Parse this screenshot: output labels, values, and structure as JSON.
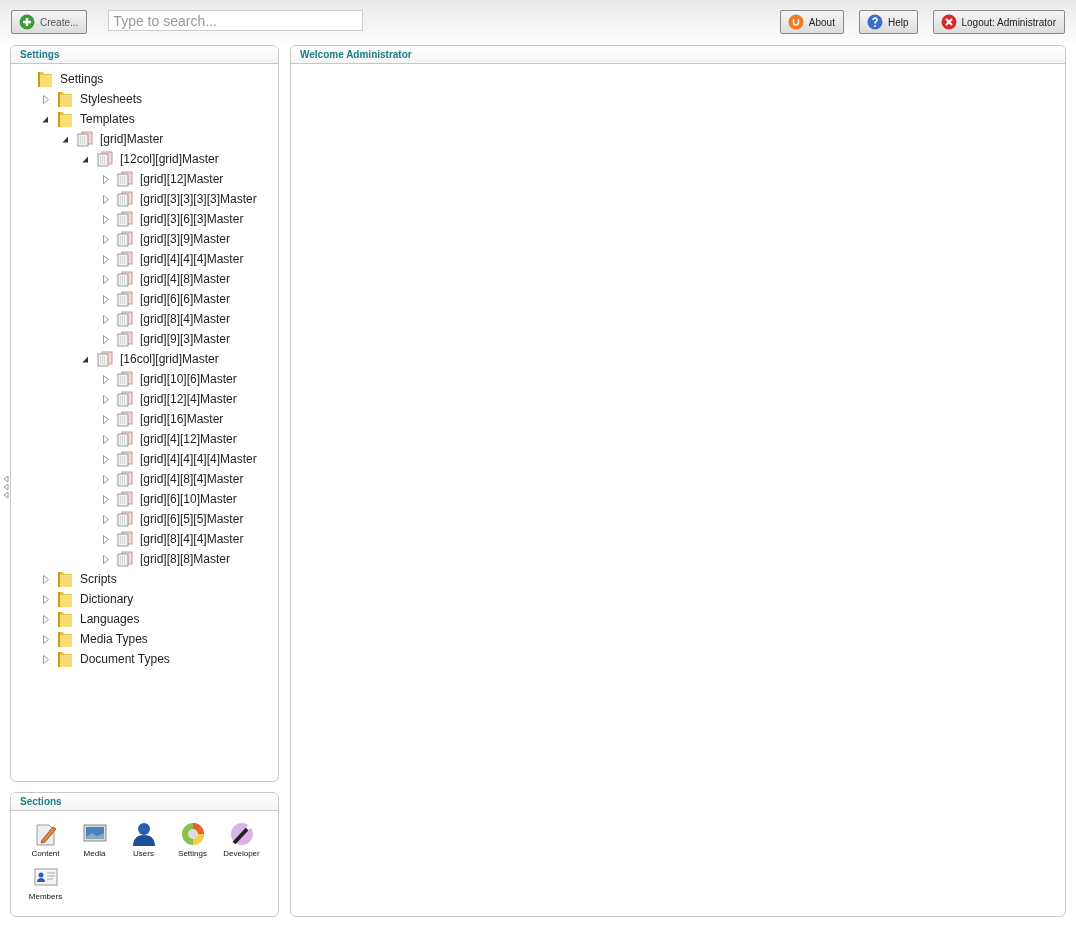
{
  "toolbar": {
    "create_button": "Create...",
    "search": {
      "placeholder": "Type to search..."
    },
    "buttons": [
      {
        "kind": "about",
        "label": "About"
      },
      {
        "kind": "help",
        "label": "Help"
      },
      {
        "kind": "logout",
        "label": "Logout: Administrator"
      }
    ]
  },
  "tree_panel": {
    "title": "Settings",
    "tree": [
      {
        "label": "Settings",
        "kind": "folder",
        "children": [
          {
            "label": "Stylesheets",
            "kind": "folder",
            "expanded": false
          },
          {
            "label": "Templates",
            "kind": "folder",
            "expanded": true,
            "children": [
              {
                "label": "[grid]Master",
                "kind": "template",
                "expanded": true,
                "children": [
                  {
                    "label": "[12col][grid]Master",
                    "kind": "template",
                    "expanded": true,
                    "children": [
                      {
                        "label": "[grid][12]Master",
                        "kind": "template",
                        "expanded": false
                      },
                      {
                        "label": "[grid][3][3][3][3]Master",
                        "kind": "template",
                        "expanded": false
                      },
                      {
                        "label": "[grid][3][6][3]Master",
                        "kind": "template",
                        "expanded": false
                      },
                      {
                        "label": "[grid][3][9]Master",
                        "kind": "template",
                        "expanded": false
                      },
                      {
                        "label": "[grid][4][4][4]Master",
                        "kind": "template",
                        "expanded": false
                      },
                      {
                        "label": "[grid][4][8]Master",
                        "kind": "template",
                        "expanded": false
                      },
                      {
                        "label": "[grid][6][6]Master",
                        "kind": "template",
                        "expanded": false
                      },
                      {
                        "label": "[grid][8][4]Master",
                        "kind": "template",
                        "expanded": false
                      },
                      {
                        "label": "[grid][9][3]Master",
                        "kind": "template",
                        "expanded": false
                      }
                    ]
                  },
                  {
                    "label": "[16col][grid]Master",
                    "kind": "template",
                    "expanded": true,
                    "children": [
                      {
                        "label": "[grid][10][6]Master",
                        "kind": "template",
                        "expanded": false
                      },
                      {
                        "label": "[grid][12][4]Master",
                        "kind": "template",
                        "expanded": false
                      },
                      {
                        "label": "[grid][16]Master",
                        "kind": "template",
                        "expanded": false
                      },
                      {
                        "label": "[grid][4][12]Master",
                        "kind": "template",
                        "expanded": false
                      },
                      {
                        "label": "[grid][4][4][4][4]Master",
                        "kind": "template",
                        "expanded": false
                      },
                      {
                        "label": "[grid][4][8][4]Master",
                        "kind": "template",
                        "expanded": false
                      },
                      {
                        "label": "[grid][6][10]Master",
                        "kind": "template",
                        "expanded": false
                      },
                      {
                        "label": "[grid][6][5][5]Master",
                        "kind": "template",
                        "expanded": false
                      },
                      {
                        "label": "[grid][8][4][4]Master",
                        "kind": "template",
                        "expanded": false
                      },
                      {
                        "label": "[grid][8][8]Master",
                        "kind": "template",
                        "expanded": false
                      }
                    ]
                  }
                ]
              }
            ]
          },
          {
            "label": "Scripts",
            "kind": "folder",
            "expanded": false
          },
          {
            "label": "Dictionary",
            "kind": "folder",
            "expanded": false
          },
          {
            "label": "Languages",
            "kind": "folder",
            "expanded": false
          },
          {
            "label": "Media Types",
            "kind": "folder",
            "expanded": false
          },
          {
            "label": "Document Types",
            "kind": "folder",
            "expanded": false
          }
        ]
      }
    ]
  },
  "sections_panel": {
    "title": "Sections",
    "sections": [
      {
        "kind": "content",
        "label": "Content"
      },
      {
        "kind": "media",
        "label": "Media"
      },
      {
        "kind": "users",
        "label": "Users"
      },
      {
        "kind": "settings",
        "label": "Settings"
      },
      {
        "kind": "developer",
        "label": "Developer"
      },
      {
        "kind": "members",
        "label": "Members"
      }
    ]
  },
  "main_panel": {
    "title": "Welcome Administrator"
  }
}
